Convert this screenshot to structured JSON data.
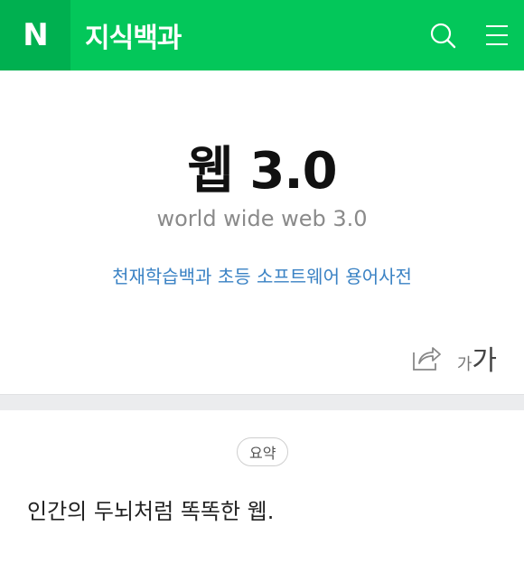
{
  "header": {
    "logo_text": "N",
    "service_title": "지식백과",
    "search_icon": "search-icon",
    "menu_icon": "hamburger-menu-icon",
    "brand_color": "#03c75a"
  },
  "article": {
    "title": "웹 3.0",
    "subtitle": "world wide web 3.0",
    "source": "천재학습백과 초등 소프트웨어 용어사전",
    "share_icon": "share-icon",
    "font_small": "가",
    "font_large": "가"
  },
  "summary": {
    "badge": "요약",
    "text": "인간의 두뇌처럼 똑똑한 웹."
  }
}
